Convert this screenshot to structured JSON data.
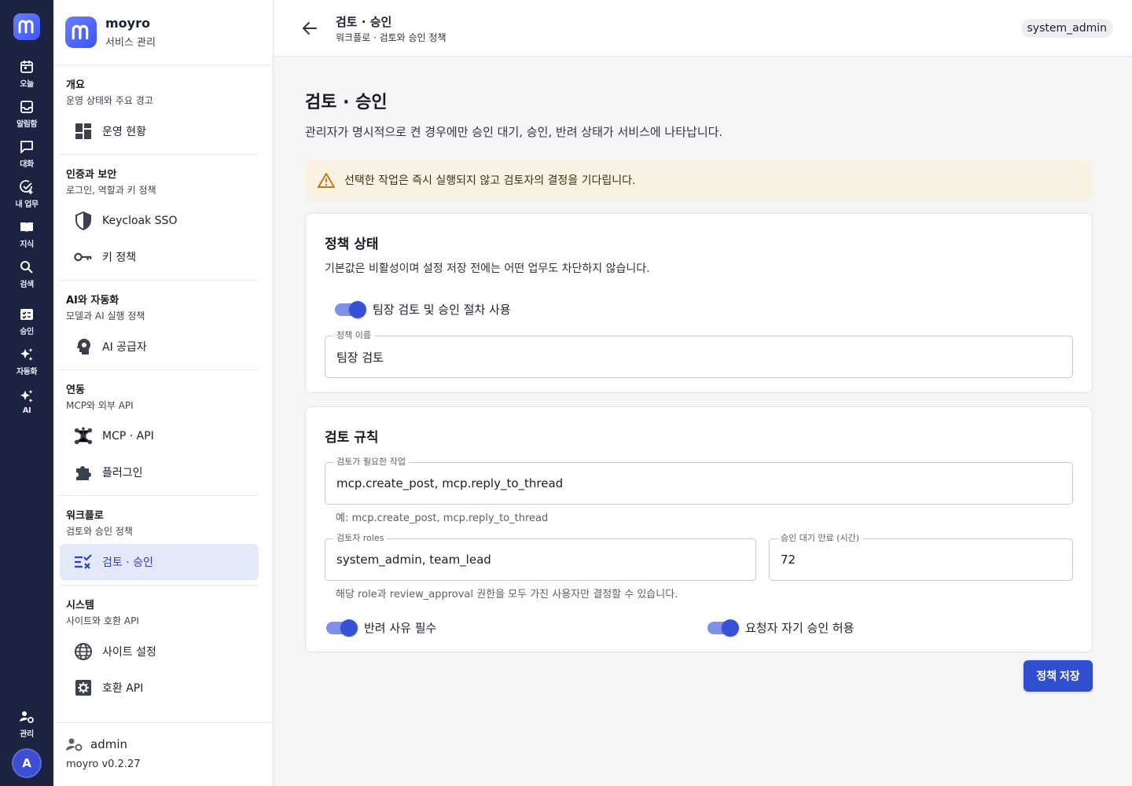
{
  "rail": {
    "items": [
      {
        "label": "오늘",
        "icon": "calendar-icon"
      },
      {
        "label": "알림함",
        "icon": "inbox-icon"
      },
      {
        "label": "대화",
        "icon": "chat-icon"
      },
      {
        "label": "내 업무",
        "icon": "task-check-icon"
      },
      {
        "label": "지식",
        "icon": "book-icon"
      },
      {
        "label": "검색",
        "icon": "search-icon"
      },
      {
        "label": "승인",
        "icon": "approval-icon"
      },
      {
        "label": "자동화",
        "icon": "sparkle-icon"
      },
      {
        "label": "AI",
        "icon": "ai-sparkle-icon"
      }
    ],
    "admin_label": "관리",
    "avatar": "A"
  },
  "brand": {
    "name": "moyro",
    "subtitle": "서비스 관리"
  },
  "nav": {
    "sections": [
      {
        "title": "개요",
        "desc": "운영 상태와 주요 경고",
        "items": [
          {
            "label": "운영 현황",
            "icon": "dashboard-icon"
          }
        ]
      },
      {
        "title": "인증과 보안",
        "desc": "로그인, 역할과 키 정책",
        "items": [
          {
            "label": "Keycloak SSO",
            "icon": "shield-icon"
          },
          {
            "label": "키 정책",
            "icon": "key-icon"
          }
        ]
      },
      {
        "title": "AI와 자동화",
        "desc": "모델과 AI 실행 정책",
        "items": [
          {
            "label": "AI 공급자",
            "icon": "ai-head-icon"
          }
        ]
      },
      {
        "title": "연동",
        "desc": "MCP와 외부 API",
        "items": [
          {
            "label": "MCP · API",
            "icon": "hub-icon"
          },
          {
            "label": "플러그인",
            "icon": "puzzle-icon"
          }
        ]
      },
      {
        "title": "워크플로",
        "desc": "검토와 승인 정책",
        "items": [
          {
            "label": "검토 · 승인",
            "icon": "checklist-icon"
          }
        ]
      },
      {
        "title": "시스템",
        "desc": "사이트와 호환 API",
        "items": [
          {
            "label": "사이트 설정",
            "icon": "globe-icon"
          },
          {
            "label": "호환 API",
            "icon": "gear-box-icon"
          }
        ]
      }
    ],
    "footer": {
      "user": "admin",
      "version": "moyro v0.2.27"
    }
  },
  "topbar": {
    "title": "검토 · 승인",
    "breadcrumb": "워크플로 · 검토와 승인 정책",
    "role": "system_admin"
  },
  "page": {
    "title": "검토 · 승인",
    "description": "관리자가 명시적으로 켠 경우에만 승인 대기, 승인, 반려 상태가 서비스에 나타납니다.",
    "alert": "선택한 작업은 즉시 실행되지 않고 검토자의 결정을 기다립니다.",
    "status_card": {
      "title": "정책 상태",
      "desc": "기본값은 비활성이며 설정 저장 전에는 어떤 업무도 차단하지 않습니다.",
      "toggle_label": "팀장 검토 및 승인 절차 사용",
      "name_label": "정책 이름",
      "name_value": "팀장 검토"
    },
    "rules_card": {
      "title": "검토 규칙",
      "actions_label": "검토가 필요한 작업",
      "actions_value": "mcp.create_post, mcp.reply_to_thread",
      "actions_hint": "예: mcp.create_post, mcp.reply_to_thread",
      "roles_label": "검토자 roles",
      "roles_value": "system_admin, team_lead",
      "timeout_label": "승인 대기 만료 (시간)",
      "timeout_value": "72",
      "roles_hint": "해당 role과 review_approval 권한을 모두 가진 사용자만 결정할 수 있습니다.",
      "reject_toggle": "반려 사유 필수",
      "self_toggle": "요청자 자기 승인 허용"
    },
    "save_label": "정책 저장"
  },
  "colors": {
    "rail_bg": "#1c2340",
    "accent": "#2f4fd0",
    "alert_bg": "#f9f1e2",
    "active_nav": "#e3e9f9"
  }
}
